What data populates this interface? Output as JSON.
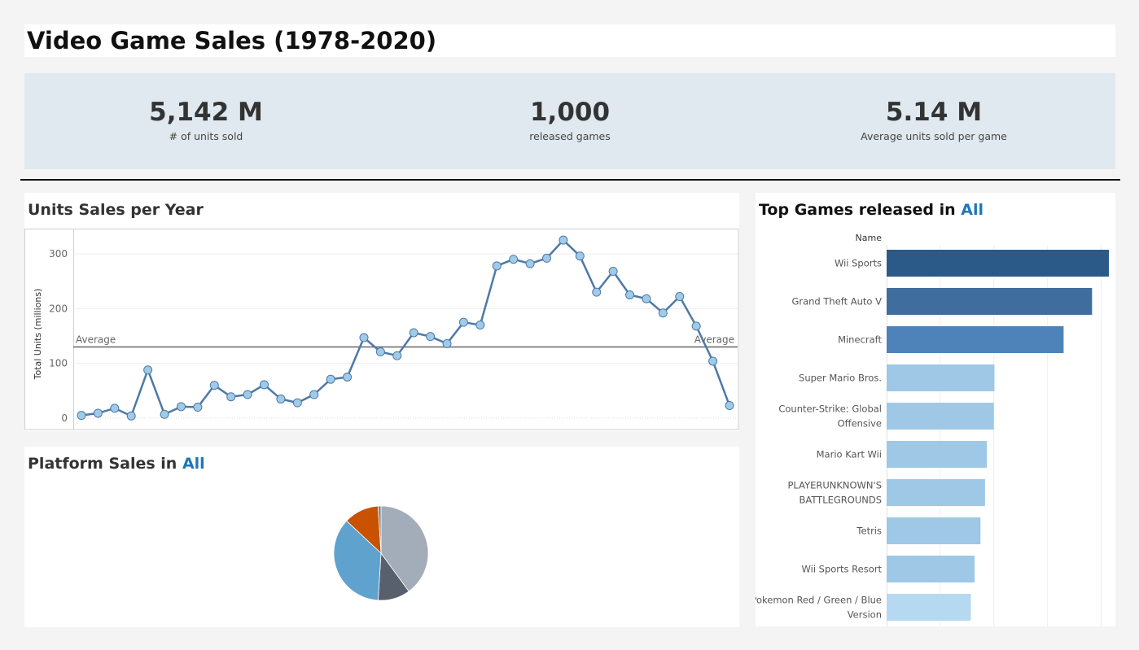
{
  "header": {
    "title": "Video Game Sales (1978-2020)"
  },
  "kpis": {
    "units": {
      "value": "5,142 M",
      "label": "# of units sold"
    },
    "games": {
      "value": "1,000",
      "label": "released games"
    },
    "avg": {
      "value": "5.14 M",
      "label": "Average units sold per game"
    }
  },
  "line_panel": {
    "title": "Units Sales per Year"
  },
  "pie_panel": {
    "title_prefix": "Platform Sales in ",
    "title_filter": "All"
  },
  "bar_panel": {
    "title_prefix": "Top Games released in ",
    "title_filter": "All"
  },
  "colors": {
    "line": "#4e79a7",
    "marker_fill": "#a0cbe8",
    "reference_line": "#666666",
    "bar_dark": "#2c5a88",
    "bar_mid": "#3f6e9e",
    "bar_med": "#4e83ba",
    "bar_light": "#9ec8e6",
    "bar_lightest": "#b5d9f0",
    "highlight": "#1f77b4"
  },
  "chart_data": [
    {
      "type": "line",
      "title": "Units Sales per Year",
      "ylabel": "Total Units (millions)",
      "xlabel": "",
      "ylim": [
        -5,
        335
      ],
      "yticks": [
        0,
        100,
        200,
        300
      ],
      "grid": true,
      "values": [
        5,
        9,
        18,
        4,
        88,
        7,
        21,
        20,
        60,
        39,
        43,
        61,
        35,
        28,
        43,
        71,
        75,
        147,
        121,
        114,
        156,
        149,
        136,
        175,
        170,
        278,
        290,
        282,
        292,
        325,
        296,
        230,
        268,
        225,
        218,
        192,
        222,
        168,
        104,
        23
      ],
      "reference_line": {
        "label": "Average",
        "value": 130
      }
    },
    {
      "type": "pie",
      "title": "Platform Sales in All",
      "slices": [
        {
          "value": 40,
          "color": "#a3acb9"
        },
        {
          "value": 11,
          "color": "#57606c"
        },
        {
          "value": 36,
          "color": "#5fa2ce"
        },
        {
          "value": 12,
          "color": "#c85200"
        },
        {
          "value": 1,
          "color": "#7b848f"
        }
      ]
    },
    {
      "type": "bar",
      "orientation": "horizontal",
      "title": "Top Games released in All",
      "column_header": "Name",
      "categories": [
        "Wii Sports",
        "Grand Theft Auto V",
        "Minecraft",
        "Super Mario Bros.",
        "Counter-Strike: Global Offensive",
        "Mario Kart Wii",
        "PLAYERUNKNOWN'S BATTLEGROUNDS",
        "Tetris",
        "Wii Sports Resort",
        "Pokemon Red / Green / Blue Version"
      ],
      "label_lines": [
        [
          "Wii Sports"
        ],
        [
          "Grand Theft Auto V"
        ],
        [
          "Minecraft"
        ],
        [
          "Super Mario Bros."
        ],
        [
          "Counter-Strike: Global",
          "Offensive"
        ],
        [
          "Mario Kart Wii"
        ],
        [
          "PLAYERUNKNOWN'S",
          "BATTLEGROUNDS"
        ],
        [
          "Tetris"
        ],
        [
          "Wii Sports Resort"
        ],
        [
          "Pokemon Red / Green / Blue",
          "Version"
        ]
      ],
      "values": [
        82.9,
        76.6,
        66.0,
        40.2,
        40.0,
        37.4,
        36.7,
        35.0,
        32.8,
        31.4
      ],
      "xlim": [
        0,
        85
      ],
      "bar_colors": [
        "#2c5a88",
        "#3f6e9e",
        "#4e83ba",
        "#9ec8e6",
        "#9ec8e6",
        "#9ec8e6",
        "#9ec8e6",
        "#9ec8e6",
        "#9ec8e6",
        "#b5d9f0"
      ]
    }
  ]
}
